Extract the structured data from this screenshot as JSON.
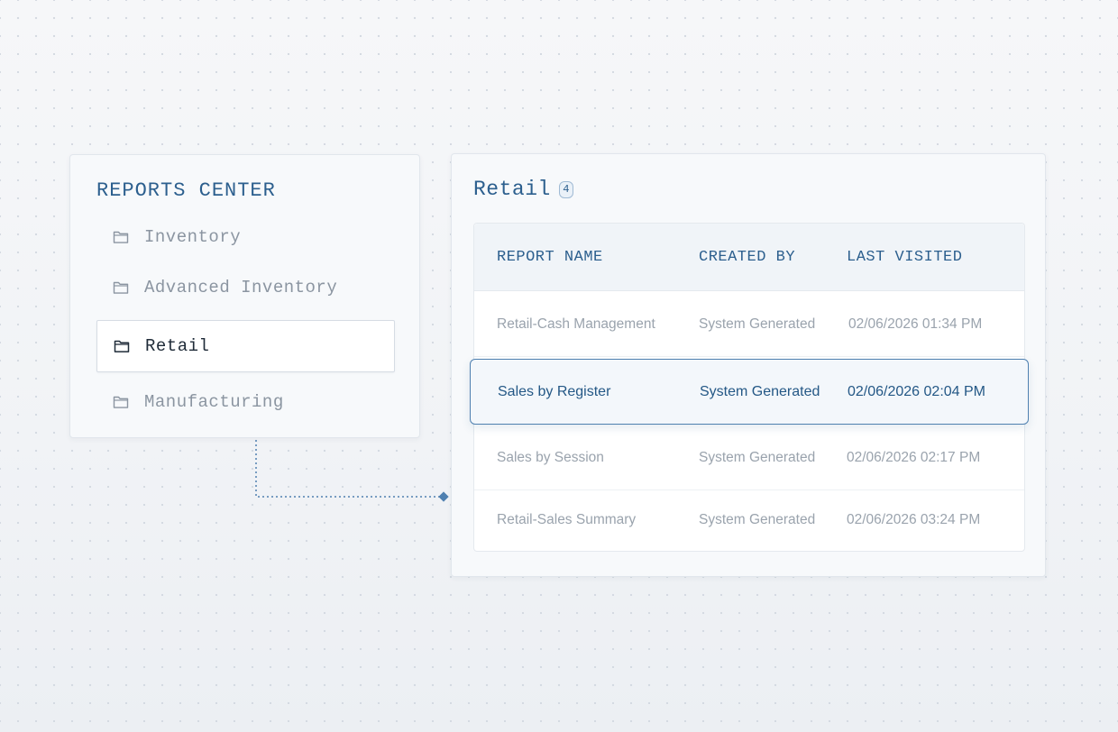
{
  "reports_center": {
    "title": "REPORTS CENTER",
    "folders": [
      {
        "label": "Inventory",
        "icon": "folder-icon",
        "active": false
      },
      {
        "label": "Advanced Inventory",
        "icon": "folder-icon",
        "active": false
      },
      {
        "label": "Retail",
        "icon": "folder-icon",
        "active": true
      },
      {
        "label": "Manufacturing",
        "icon": "folder-icon",
        "active": false
      }
    ]
  },
  "retail": {
    "title": "Retail",
    "count": "4",
    "columns": [
      "REPORT NAME",
      "CREATED BY",
      "LAST VISITED"
    ],
    "rows": [
      {
        "name": "Retail-Cash Management",
        "created_by": "System Generated",
        "last_visited": "02/06/2026 01:34 PM",
        "selected": false
      },
      {
        "name": "Sales by Register",
        "created_by": "System Generated",
        "last_visited": "02/06/2026 02:04 PM",
        "selected": true
      },
      {
        "name": "Sales by Session",
        "created_by": "System Generated",
        "last_visited": "02/06/2026 02:17 PM",
        "selected": false
      },
      {
        "name": "Retail-Sales Summary",
        "created_by": "System Generated",
        "last_visited": "02/06/2026 03:24 PM",
        "selected": false
      }
    ]
  },
  "colors": {
    "accent": "#2c5f8e",
    "selected_border": "#4f80b0",
    "muted_text": "#9aa3ad",
    "active_text": "#1f2b38"
  }
}
